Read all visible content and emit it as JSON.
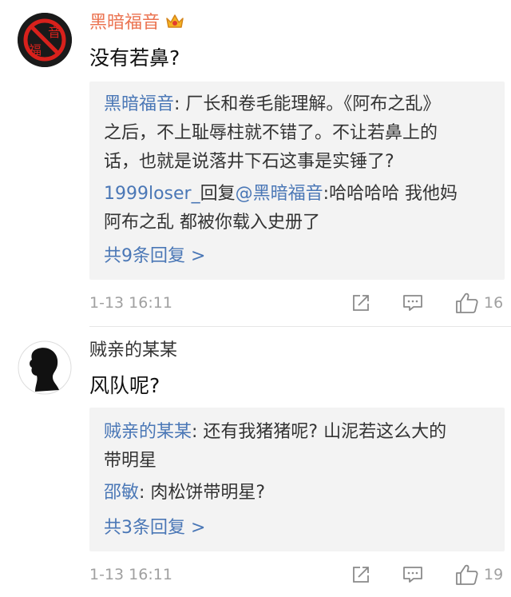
{
  "comments": [
    {
      "username": "黑暗福音",
      "avatar_text": [
        "音",
        "福"
      ],
      "content": "没有若鼻?",
      "replies": [
        {
          "name": "黑暗福音",
          "separator": ": ",
          "lines": [
            "厂长和卷毛能理解。《阿布之乱》",
            "之后，不上耻辱柱就不错了。不让若鼻上的",
            "话，也就是说落井下石这事是实锤了?"
          ]
        },
        {
          "name": "1999loser_",
          "reply_word": "回复",
          "mention": "@黑暗福音",
          "separator": ":",
          "lines": [
            "哈哈哈哈 我他妈",
            "阿布之乱 都被你载入史册了"
          ]
        }
      ],
      "more_replies": "共9条回复 >",
      "timestamp": "1-13 16:11",
      "like_count": "16"
    },
    {
      "username": "贼亲的某某",
      "content": "风队呢?",
      "replies": [
        {
          "name": "贼亲的某某",
          "separator": ": ",
          "lines": [
            "还有我猪猪呢? 山泥若这么大的",
            "带明星"
          ]
        },
        {
          "name": "邵敏",
          "separator": ": ",
          "lines": [
            "肉松饼带明星?"
          ]
        }
      ],
      "more_replies": "共3条回复 >",
      "timestamp": "1-13 16:11",
      "like_count": "19"
    }
  ],
  "colors": {
    "vip_name": "#eb7350",
    "link": "#4a77b6",
    "meta": "#a0a0a0",
    "reply_bg": "#f3f3f3"
  },
  "icons": [
    "repost-icon",
    "comment-icon",
    "like-icon",
    "vip-crown-icon"
  ]
}
